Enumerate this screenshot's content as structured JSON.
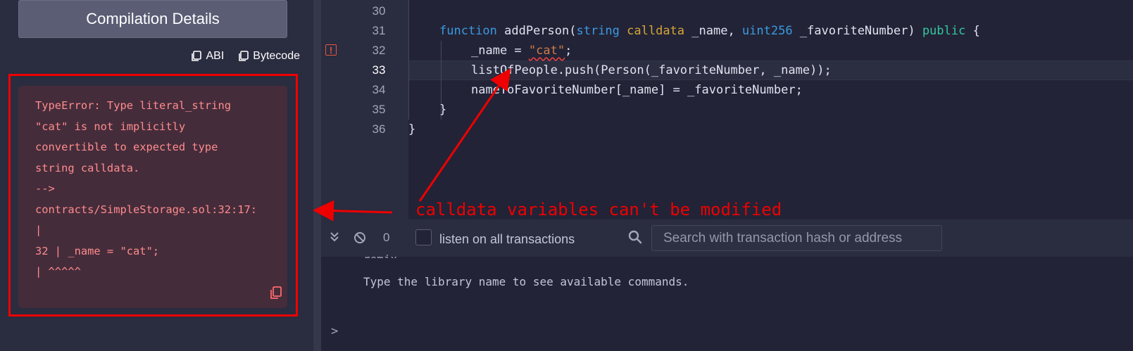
{
  "left_panel": {
    "compile_details_label": "Compilation Details",
    "abi_label": "ABI",
    "bytecode_label": "Bytecode",
    "error_lines": [
      "TypeError: Type literal_string",
      "\"cat\" is not implicitly",
      "convertible to expected type",
      "string calldata.",
      "-->",
      "contracts/SimpleStorage.sol:32:17:",
      "|",
      "32 | _name = \"cat\";",
      "| ^^^^^"
    ]
  },
  "editor": {
    "line_numbers": [
      "30",
      "31",
      "32",
      "33",
      "34",
      "35",
      "36"
    ],
    "active_line": "33",
    "error_line": "32",
    "code": {
      "l31_kw_function": "function",
      "l31_name": " addPerson(",
      "l31_type_string": "string",
      "l31_kw_calldata": " calldata",
      "l31_param_name": " _name, ",
      "l31_type_uint": "uint256",
      "l31_param_fav": " _favoriteNumber) ",
      "l31_kw_public": "public",
      "l31_brace": " {",
      "l32_pre": "_name = ",
      "l32_str": "\"cat\"",
      "l32_post": ";",
      "l33": "listOfPeople.push(Person(_favoriteNumber, _name));",
      "l34": "nameToFavoriteNumber[_name] = _favoriteNumber;",
      "l35": "}",
      "l36": "}"
    }
  },
  "annotation": {
    "text": "calldata variables can't be modified",
    "color": "#e00000"
  },
  "terminal_bar": {
    "tx_count": "0",
    "listen_label": "listen on all transactions",
    "listen_checked": false,
    "search_placeholder": "Search with transaction hash or address"
  },
  "terminal": {
    "cut_line": "remix",
    "help_text": "Type the library name to see available commands.",
    "prompt": ">"
  },
  "icons": [
    "copy-icon",
    "double-chevron-down-icon",
    "ban-icon",
    "search-icon",
    "error-marker-icon"
  ]
}
